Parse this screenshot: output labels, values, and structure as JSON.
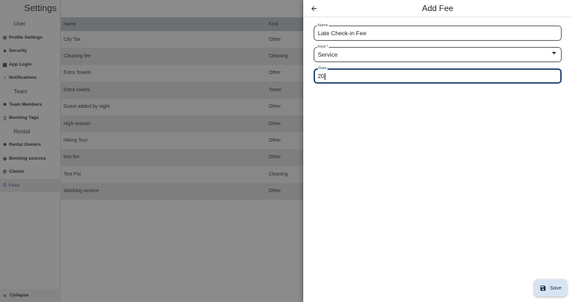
{
  "settings": {
    "title": "Settings",
    "sections": [
      {
        "label": "User",
        "items": [
          {
            "label": "Profile Settings",
            "icon": "gear-icon"
          },
          {
            "label": "Security",
            "icon": "lock-icon"
          },
          {
            "label": "App Login",
            "icon": "qr-code-icon"
          },
          {
            "label": "Notifications",
            "icon": "bell-icon"
          }
        ]
      },
      {
        "label": "Team",
        "items": [
          {
            "label": "Team Members",
            "icon": "people-icon"
          },
          {
            "label": "Booking Tags",
            "icon": "bookmark-icon"
          }
        ]
      },
      {
        "label": "Rental",
        "items": [
          {
            "label": "Rental Owners",
            "icon": "people-icon"
          },
          {
            "label": "Booking sources",
            "icon": "globe-icon"
          },
          {
            "label": "Clients",
            "icon": "phone-icon"
          },
          {
            "label": "Fees",
            "icon": "dollar-icon",
            "active": true
          }
        ]
      }
    ],
    "collapse_label": "Collapse"
  },
  "table": {
    "columns": {
      "name": "Name",
      "kind": "Kind"
    },
    "rows": [
      {
        "name": "City Tax",
        "kind": "Other"
      },
      {
        "name": "Cleaning fee",
        "kind": "Cleaning"
      },
      {
        "name": "Extra Towels",
        "kind": "Other"
      },
      {
        "name": "Extra towels",
        "kind": "Towel"
      },
      {
        "name": "Guest added by night",
        "kind": "Other"
      },
      {
        "name": "High season",
        "kind": "Other"
      },
      {
        "name": "Hiking Tour",
        "kind": "Other"
      },
      {
        "name": "test fee",
        "kind": "Other"
      },
      {
        "name": "Test Pol",
        "kind": "Cleaning"
      },
      {
        "name": "Washing service",
        "kind": "Other"
      }
    ]
  },
  "drawer": {
    "title": "Add Fee",
    "back_icon": "arrow-left-icon",
    "fields": {
      "name": {
        "label": "Name",
        "value": "Late Check-in Fee"
      },
      "kind": {
        "label": "Kind *",
        "value": "Service"
      },
      "rate": {
        "label": "Rate",
        "value": "20"
      }
    },
    "save_label": "Save",
    "save_icon": "save-icon"
  },
  "colors": {
    "accent": "#22456e",
    "save_bg": "#d8e4f1",
    "overlay": "#8b8b8b"
  }
}
